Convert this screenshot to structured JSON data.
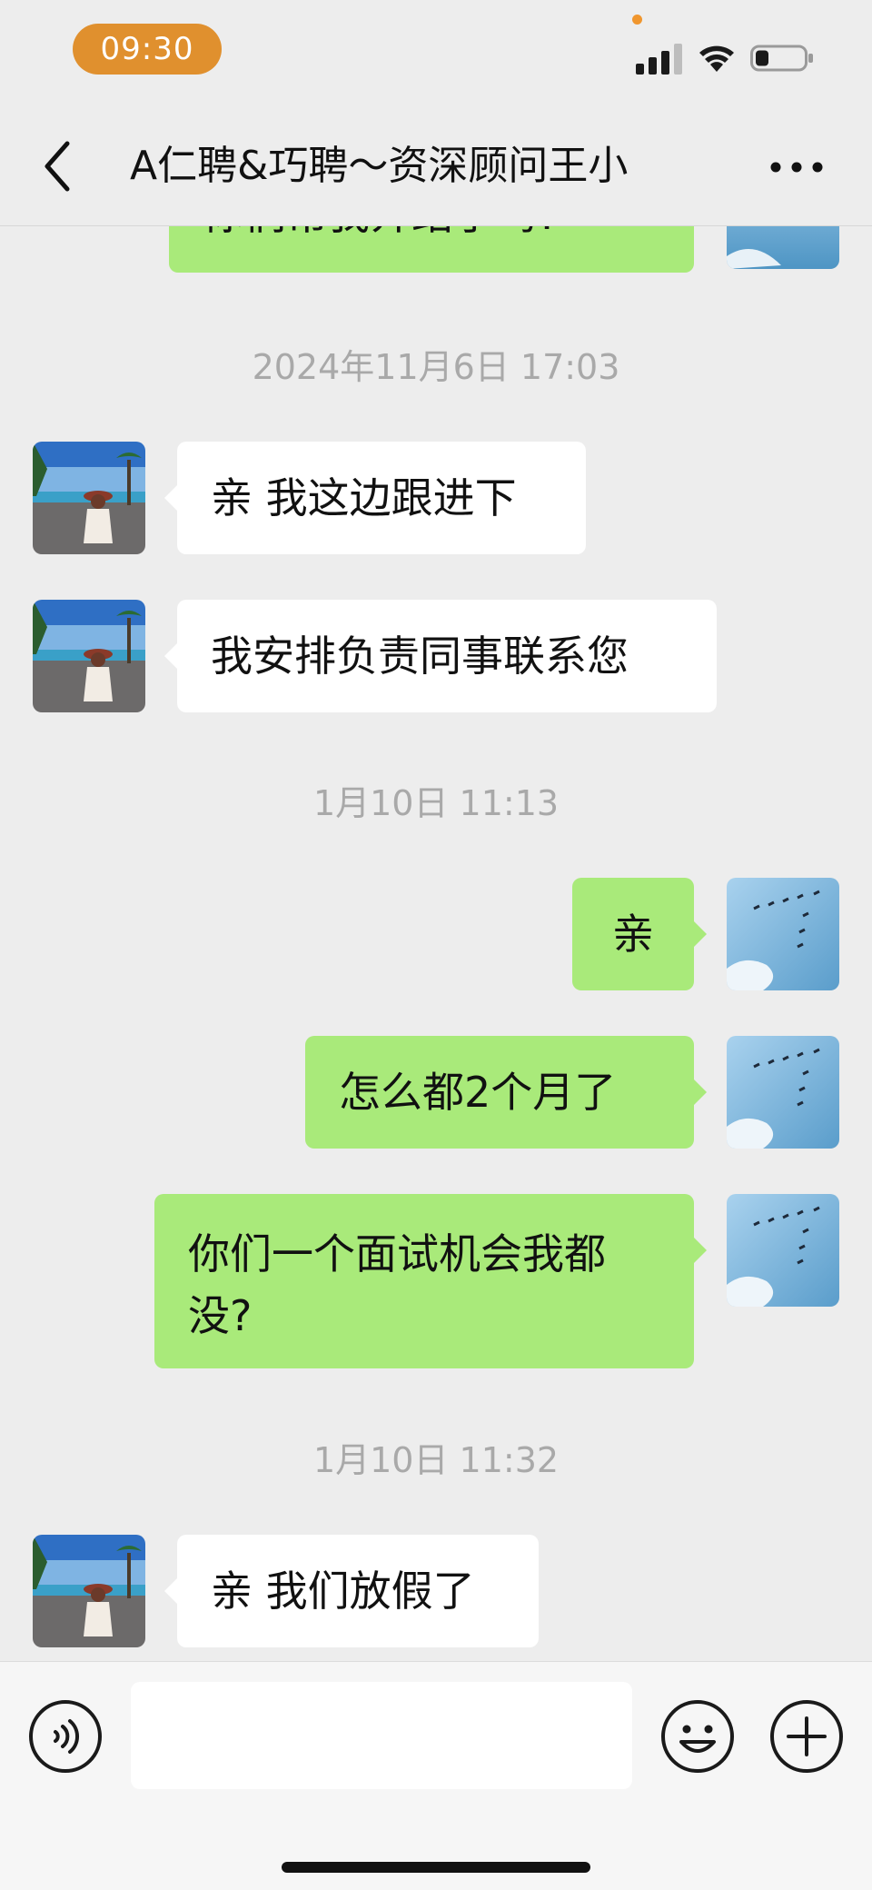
{
  "status_bar": {
    "time": "09:30"
  },
  "nav": {
    "title": "A仁聘&巧聘～资深顾问王小"
  },
  "messages": [
    {
      "side": "right",
      "text": "你们帮我介绍了吗?"
    },
    {
      "type": "timestamp",
      "text": "2024年11月6日 17:03"
    },
    {
      "side": "left",
      "text": "亲 我这边跟进下"
    },
    {
      "side": "left",
      "text": "我安排负责同事联系您"
    },
    {
      "type": "timestamp",
      "text": "1月10日 11:13"
    },
    {
      "side": "right",
      "text": "亲"
    },
    {
      "side": "right",
      "text": "怎么都2个月了"
    },
    {
      "side": "right",
      "text": "你们一个面试机会我都没?"
    },
    {
      "type": "timestamp",
      "text": "1月10日 11:32"
    },
    {
      "side": "left",
      "text": "亲 我们放假了"
    }
  ],
  "input_bar": {
    "value": "",
    "placeholder": ""
  },
  "icons": {
    "back": "chevron-left-icon",
    "more": "more-icon",
    "voice": "voice-icon",
    "emoji": "emoji-icon",
    "plus": "plus-icon"
  },
  "colors": {
    "background": "#ededed",
    "bubble_sent": "#a9ea7a",
    "bubble_received": "#ffffff",
    "time_pill": "#e0902e",
    "timestamp_text": "#a9a9a9"
  }
}
